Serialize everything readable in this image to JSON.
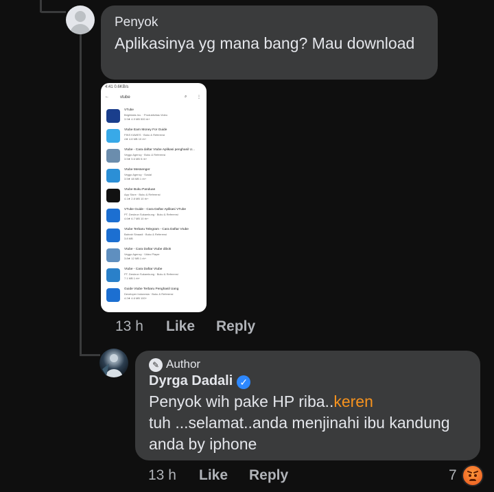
{
  "comments": [
    {
      "author": "Penyok",
      "text": "Aplikasinya yg mana bang? Mau download",
      "time": "13 h",
      "like_label": "Like",
      "reply_label": "Reply"
    },
    {
      "badge_label": "Author",
      "author": "Dyrga Dadali",
      "text_line1_pre": "Penyok wih pake HP riba..",
      "text_line1_highlight": "keren",
      "text_line2": "tuh ...selamat..anda menjinahi ibu kandung",
      "text_line3": "anda by iphone",
      "time": "13 h",
      "like_label": "Like",
      "reply_label": "Reply",
      "reaction_count": "7"
    }
  ],
  "phone_screenshot": {
    "status": "4:41 0.6KB/s",
    "search_query": "vtube",
    "apps": [
      {
        "title": "VTube",
        "developer": "Brightlabs Inc. · Produktivitas Video",
        "rating": "3.9★ 4.9 MB 500 rb+",
        "color": "#1a3e8c"
      },
      {
        "title": "Vtube Earn Money For Guide",
        "developer": "FINS KAWES · Buku & Referensi",
        "rating": "4★ 4.8 MB 10 rb+",
        "color": "#38a9e8"
      },
      {
        "title": "Vtube - Cara daftar Vtube Aplikasi penghasil U...",
        "developer": "Veggo Agency · Buku & Referensi",
        "rating": "3.5★ 5.6 MB 5 rb+",
        "color": "#6b8dad"
      },
      {
        "title": "Vtube Messenger",
        "developer": "Veggo Agency · Sosial",
        "rating": "3.5★ 48 MB 1 rb+",
        "color": "#2b8fd6"
      },
      {
        "title": "Vtube Buku Panduan",
        "developer": "App Store · Buku & Referensi",
        "rating": "4.1★ 2.8 MB 10 rb+",
        "color": "#111111"
      },
      {
        "title": "VTube Guide - Cara Daftar Aplikasi VTube",
        "developer": "PT. Deskrun Sukamkung · Buku & Referensi",
        "rating": "4.6★ 6.7 MB 10 rb+",
        "color": "#1c6fd1"
      },
      {
        "title": "Vtube Terbaru Telegram - Cara Daftar Vtube",
        "developer": "Bahrah Sinaadi · Buku & Referensi",
        "rating": "3.8 MB",
        "color": "#1c6fd1"
      },
      {
        "title": "Vtube - Cara Daftar Vtube dibok",
        "developer": "Veggo Agency · Video Player",
        "rating": "3.8★ 12 MB 1 rb+",
        "color": "#5f8fbf"
      },
      {
        "title": "Vtube - Cara Daftar Vtube",
        "developer": "PT. Deskrun Sukamkung · Buku & Referensi",
        "rating": "7.1 MB 1 rb+",
        "color": "#2a80c9"
      },
      {
        "title": "Guide Vtube Terbaru Penghasil Uang",
        "developer": "Developer Indonesia · Buku & Referensi",
        "rating": "4.2★ 4.6 MB 100+",
        "color": "#1c6fd1"
      }
    ]
  },
  "colors": {
    "background": "#0f0f0f",
    "bubble": "#3a3b3c",
    "highlight": "#f7931e",
    "verified": "#2d88ff"
  }
}
